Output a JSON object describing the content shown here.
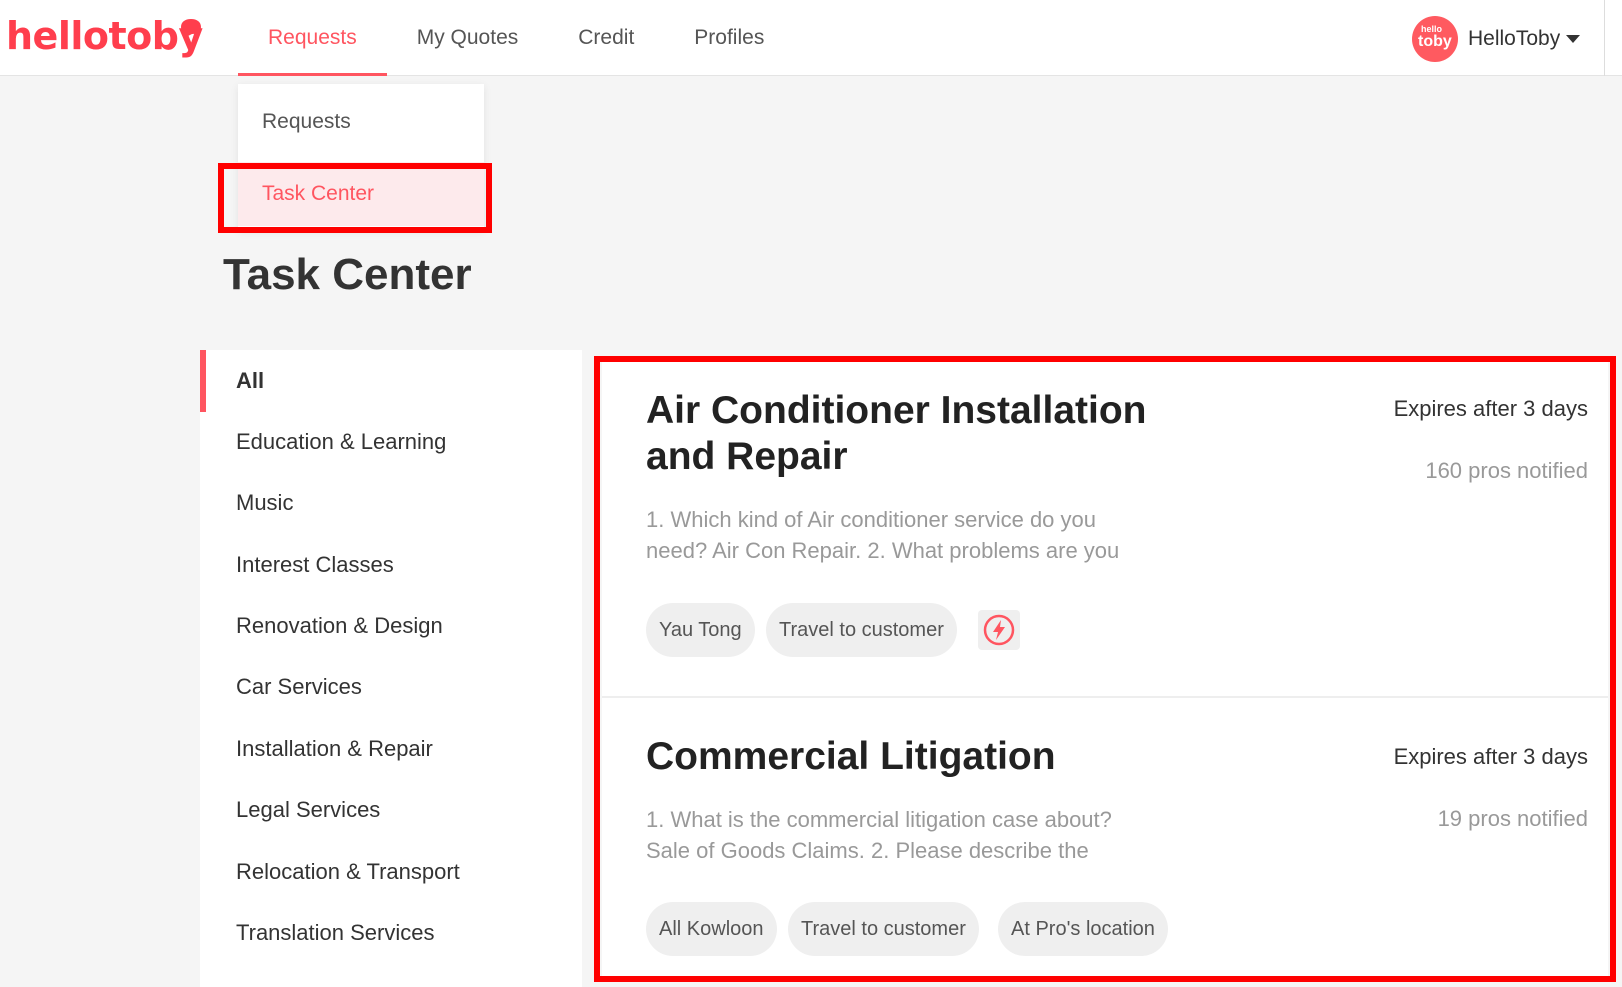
{
  "header": {
    "logo": "hellotoby",
    "nav": [
      "Requests",
      "My Quotes",
      "Credit",
      "Profiles"
    ],
    "avatar_small": "hello",
    "avatar_big": "toby",
    "user_name": "HelloToby"
  },
  "dropdown": {
    "items": [
      "Requests",
      "Task Center"
    ]
  },
  "page_title": "Task Center",
  "sidebar": {
    "items": [
      "All",
      "Education & Learning",
      "Music",
      "Interest Classes",
      "Renovation & Design",
      "Car Services",
      "Installation & Repair",
      "Legal Services",
      "Relocation & Transport",
      "Translation Services"
    ]
  },
  "cards": [
    {
      "title_line1": "Air Conditioner Installation",
      "title_line2": "and Repair",
      "expires": "Expires after 3 days",
      "pros": "160 pros notified",
      "desc_line1": "1. Which kind of Air conditioner service do you",
      "desc_line2": "need? Air Con Repair. 2. What problems are you",
      "chips": [
        "Yau Tong",
        "Travel to customer"
      ]
    },
    {
      "title_line1": "Commercial Litigation",
      "expires": "Expires after 3 days",
      "pros": "19 pros notified",
      "desc_line1": "1. What is the commercial litigation case about?",
      "desc_line2": "Sale of Goods Claims. 2. Please describe the",
      "chips": [
        "All Kowloon",
        "Travel to customer",
        "At Pro's location"
      ]
    }
  ],
  "colors": {
    "brand": "#ff5560",
    "highlight": "#ff0000"
  }
}
